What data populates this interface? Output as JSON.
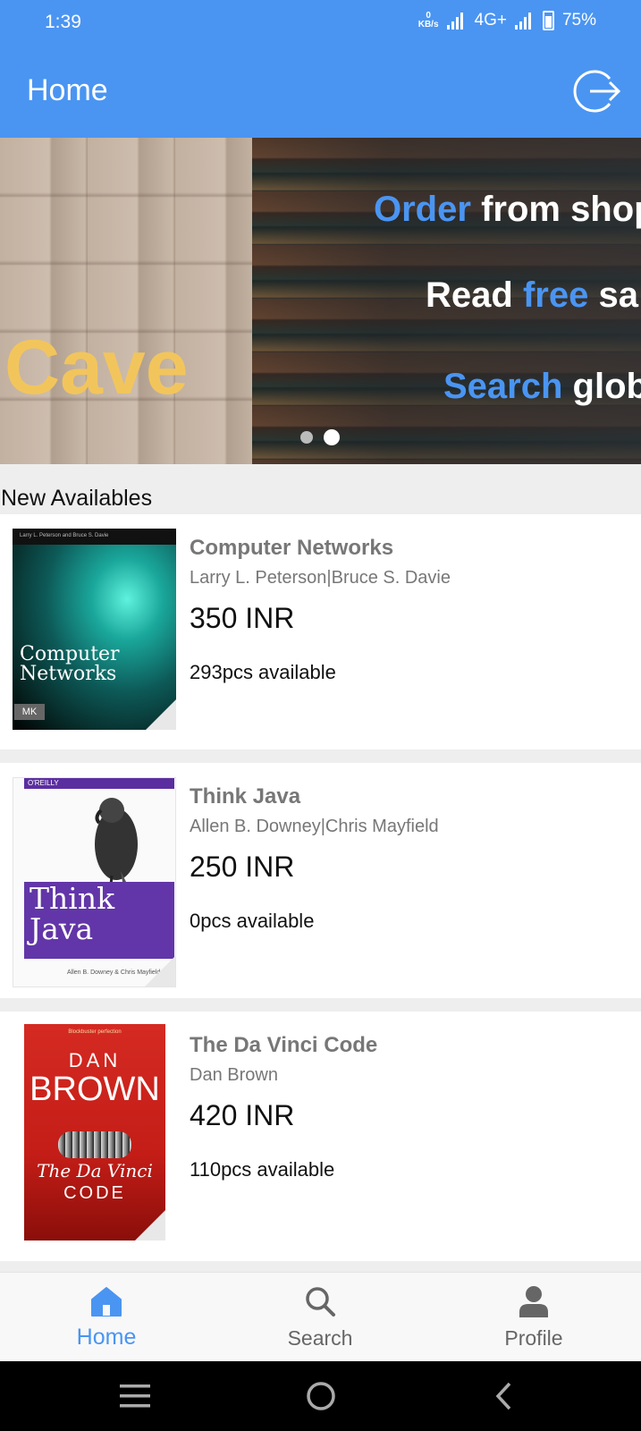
{
  "status_bar": {
    "time": "1:39",
    "speed_value": "0",
    "speed_unit": "KB/s",
    "network": "4G+",
    "battery": "75%"
  },
  "app_bar": {
    "title": "Home",
    "action_icon": "logout-icon"
  },
  "banner": {
    "brand": "Cave",
    "lines": [
      {
        "highlight": "Order",
        "rest": "from shop"
      },
      {
        "prefix": "Read",
        "highlight": "free",
        "rest": "sa"
      },
      {
        "highlight": "Search",
        "rest": "glob"
      }
    ],
    "page_count": 2,
    "active_page": 2
  },
  "section_title": "New Availables",
  "books": [
    {
      "title": "Computer Networks",
      "authors": "Larry L. Peterson|Bruce S. Davie",
      "price": "350 INR",
      "availability": "293pcs available",
      "cover": {
        "top": "Larry L. Peterson and Bruce S. Davie",
        "line1": "Computer",
        "line2": "Networks",
        "publisher": "MK"
      }
    },
    {
      "title": "Think Java",
      "authors": "Allen B. Downey|Chris Mayfield",
      "price": "250 INR",
      "availability": "0pcs available",
      "cover": {
        "publisher": "O'REILLY",
        "line1": "Think",
        "line2": "Java",
        "foot": "Allen B. Downey & Chris Mayfield"
      }
    },
    {
      "title": "The Da Vinci Code",
      "authors": "Dan Brown",
      "price": "420 INR",
      "availability": "110pcs available",
      "cover": {
        "top": "Blockbuster perfection",
        "line1": "DAN",
        "line2": "BROWN",
        "line3": "The Da Vinci",
        "line4": "CODE"
      }
    }
  ],
  "bottom_nav": [
    {
      "label": "Home",
      "icon": "home-icon",
      "active": true
    },
    {
      "label": "Search",
      "icon": "search-icon",
      "active": false
    },
    {
      "label": "Profile",
      "icon": "profile-icon",
      "active": false
    }
  ],
  "colors": {
    "primary": "#4a95f2",
    "brand_text": "#f2c55c"
  }
}
